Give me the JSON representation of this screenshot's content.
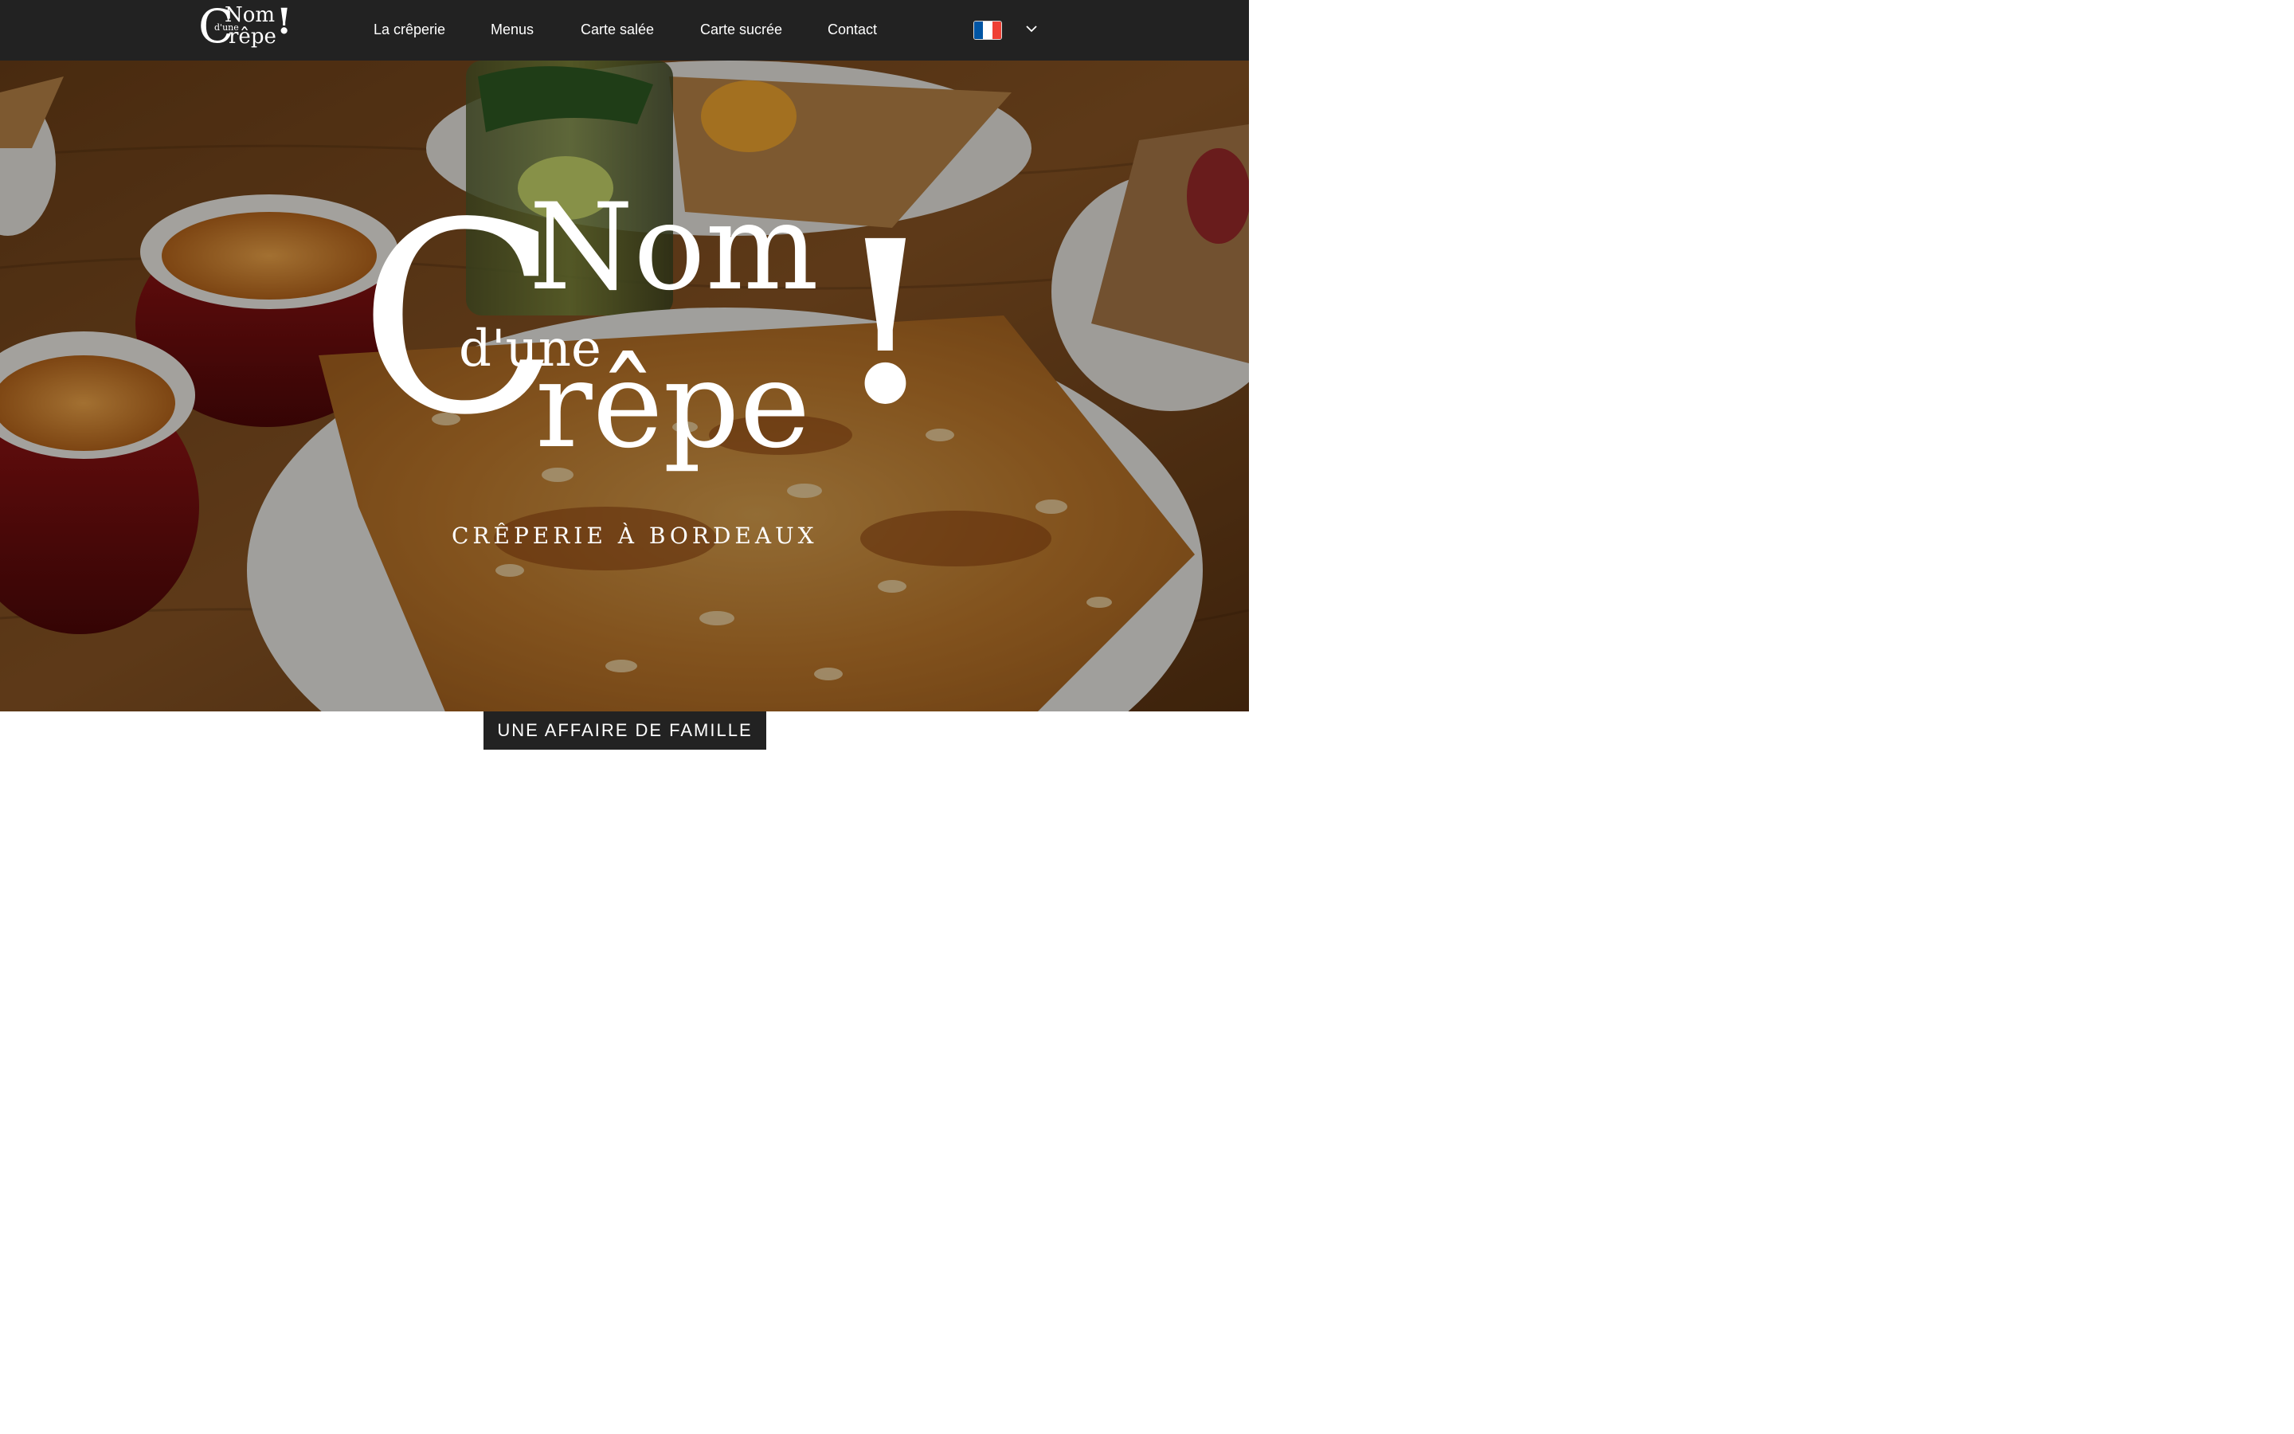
{
  "brand": {
    "logo_c": "C",
    "logo_nom": "Nom",
    "logo_dune": "d'une",
    "logo_repe": "rêpe",
    "logo_exclaim": "!"
  },
  "nav": {
    "items": [
      {
        "label": "La crêperie"
      },
      {
        "label": "Menus"
      },
      {
        "label": "Carte salée"
      },
      {
        "label": "Carte sucrée"
      },
      {
        "label": "Contact"
      }
    ]
  },
  "language": {
    "flag_icon": "france-flag-icon",
    "flag_colors": [
      "#0055A4",
      "#FFFFFF",
      "#EF4135"
    ],
    "dropdown_icon": "chevron-down-icon"
  },
  "hero": {
    "tagline": "CRÊPERIE À BORDEAUX"
  },
  "section": {
    "badge": "UNE AFFAIRE DE FAMILLE"
  },
  "colors": {
    "header_bg": "#222222",
    "badge_bg": "#222222",
    "text": "#FFFFFF"
  }
}
